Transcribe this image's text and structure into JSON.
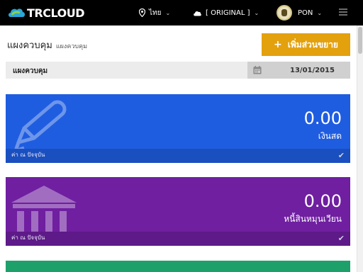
{
  "header": {
    "logo_tr": "TR",
    "logo_cloud": "CLOUD",
    "language": "ไทย",
    "version": "[ ORIGINAL ]",
    "user": "PON",
    "accent_bg": "#000000"
  },
  "page": {
    "title": "แผงควบคุม",
    "subtitle": "แผงควบคุม",
    "add_button": "เพิ่มส่วนขยาย",
    "add_button_color": "#e3a10e"
  },
  "filter": {
    "label": "แผงควบคุม",
    "date": "13/01/2015"
  },
  "cards": [
    {
      "value": "0.00",
      "label": "เงินสด",
      "note": "ค่า ณ ปัจจุบัน",
      "color": "#1f5de0",
      "icon": "pencil-icon"
    },
    {
      "value": "0.00",
      "label": "หนี้สินหมุนเวียน",
      "note": "ค่า ณ ปัจจุบัน",
      "color": "#6f1fa0",
      "icon": "bank-icon"
    },
    {
      "color": "#1ea06a"
    }
  ]
}
